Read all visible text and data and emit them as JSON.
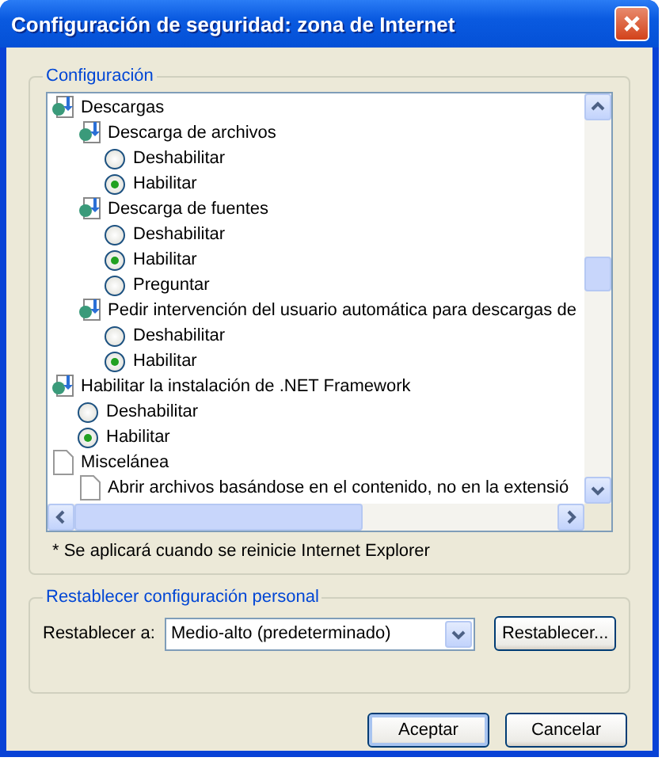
{
  "window": {
    "title": "Configuración de seguridad: zona de Internet"
  },
  "settings_group": {
    "title": "Configuración",
    "tree": [
      {
        "kind": "settings",
        "label": "Descargas",
        "children": [
          {
            "kind": "settings",
            "label": "Descarga de archivos",
            "children": [
              {
                "kind": "option",
                "label": "Deshabilitar",
                "selected": false
              },
              {
                "kind": "option",
                "label": "Habilitar",
                "selected": true
              }
            ]
          },
          {
            "kind": "settings",
            "label": "Descarga de fuentes",
            "children": [
              {
                "kind": "option",
                "label": "Deshabilitar",
                "selected": false
              },
              {
                "kind": "option",
                "label": "Habilitar",
                "selected": true
              },
              {
                "kind": "option",
                "label": "Preguntar",
                "selected": false
              }
            ]
          },
          {
            "kind": "settings",
            "label": "Pedir intervención del usuario automática para descargas de",
            "children": [
              {
                "kind": "option",
                "label": "Deshabilitar",
                "selected": false
              },
              {
                "kind": "option",
                "label": "Habilitar",
                "selected": true
              }
            ]
          }
        ]
      },
      {
        "kind": "settings",
        "label": "Habilitar la instalación de .NET Framework",
        "children": [
          {
            "kind": "option",
            "label": "Deshabilitar",
            "selected": false
          },
          {
            "kind": "option",
            "label": "Habilitar",
            "selected": true
          }
        ]
      },
      {
        "kind": "document",
        "label": "Miscelánea",
        "children": [
          {
            "kind": "document",
            "label": "Abrir archivos basándose en el contenido, no en la extensió"
          }
        ]
      }
    ],
    "note": "* Se aplicará cuando se reinicie Internet Explorer"
  },
  "reset_group": {
    "title": "Restablecer configuración personal",
    "label": "Restablecer a:",
    "value": "Medio-alto (predeterminado)",
    "button": "Restablecer..."
  },
  "buttons": [
    "Aceptar",
    "Cancelar"
  ]
}
